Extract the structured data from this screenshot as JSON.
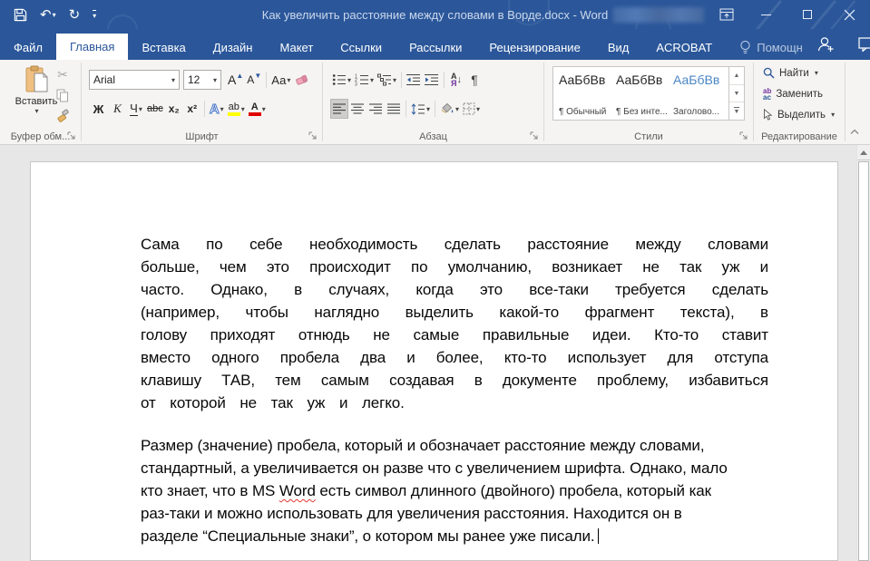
{
  "titlebar": {
    "title": "Как увеличить расстояние между словами в Ворде.docx - Word"
  },
  "icons": {
    "undo": "↶",
    "redo": "↻",
    "dropdown": "▾",
    "cut": "✂",
    "pilcrow": "¶",
    "grow_font_letter": "А",
    "up_mark": "▲",
    "down_mark": "▼",
    "sort_top": "А",
    "sort_bottom": "Я",
    "sort_arrow": "↓",
    "scroll_up": "▲",
    "scroll_down": "▼"
  },
  "tabs": {
    "file": "Файл",
    "home": "Главная",
    "insert": "Вставка",
    "design": "Дизайн",
    "layout": "Макет",
    "references": "Ссылки",
    "mailings": "Рассылки",
    "review": "Рецензирование",
    "view": "Вид",
    "acrobat": "ACROBAT",
    "assistant": "Помощн"
  },
  "ribbon": {
    "clipboard": {
      "paste": "Вставить",
      "label": "Буфер обм..."
    },
    "font": {
      "label": "Шрифт",
      "name": "Arial",
      "size": "12",
      "bold": "Ж",
      "italic": "К",
      "underline": "Ч",
      "strike": "abc",
      "subscript": "x₂",
      "superscript": "x²",
      "change_case": "Аа",
      "effects": "А",
      "highlight": "ab",
      "font_color": "А"
    },
    "paragraph": {
      "label": "Абзац"
    },
    "styles": {
      "label": "Стили",
      "items": [
        {
          "preview": "АаБбВв",
          "name": "¶ Обычный"
        },
        {
          "preview": "АаБбВв",
          "name": "¶ Без инте..."
        },
        {
          "preview": "АаБбВв",
          "name": "Заголово..."
        }
      ]
    },
    "editing": {
      "label": "Редактирование",
      "find": "Найти",
      "replace": "Заменить",
      "select": "Выделить",
      "replace_r1": "ab",
      "replace_r2": "ac"
    }
  },
  "document": {
    "p1_lines": [
      "Сама по себе необходимость сделать расстояние между словами",
      "больше, чем это происходит по умолчанию, возникает не так уж и",
      "часто. Однако, в случаях, когда это все-таки требуется сделать",
      "(например, чтобы наглядно выделить какой-то фрагмент текста), в",
      "голову приходят отнюдь не самые правильные идеи. Кто-то ставит",
      "вместо одного пробела два и более, кто-то использует для отступа",
      "клавишу ТАВ, тем самым создавая в документе проблему, избавиться",
      "от которой не так уж и легко."
    ],
    "p2_lines": [
      "Размер (значение) пробела, который и обозначает расстояние между словами,",
      "стандартный, а увеличивается он разве что с увеличением шрифта. Однако, мало",
      "раз-таки и можно использовать для увеличения расстояния. Находится он в",
      "разделе “Специальные знаки”, о котором мы ранее уже писали."
    ],
    "p2_line3_before": "кто знает, что в MS ",
    "p2_line3_word": "Word",
    "p2_line3_after": " есть символ длинного (двойного) пробела, который как"
  },
  "colors": {
    "accent": "#2B579A",
    "highlight_bar": "#FFFF00",
    "font_color_bar": "#E00000",
    "heading_style_blue": "#4A86C5",
    "misspell_underline": "#E53935"
  }
}
